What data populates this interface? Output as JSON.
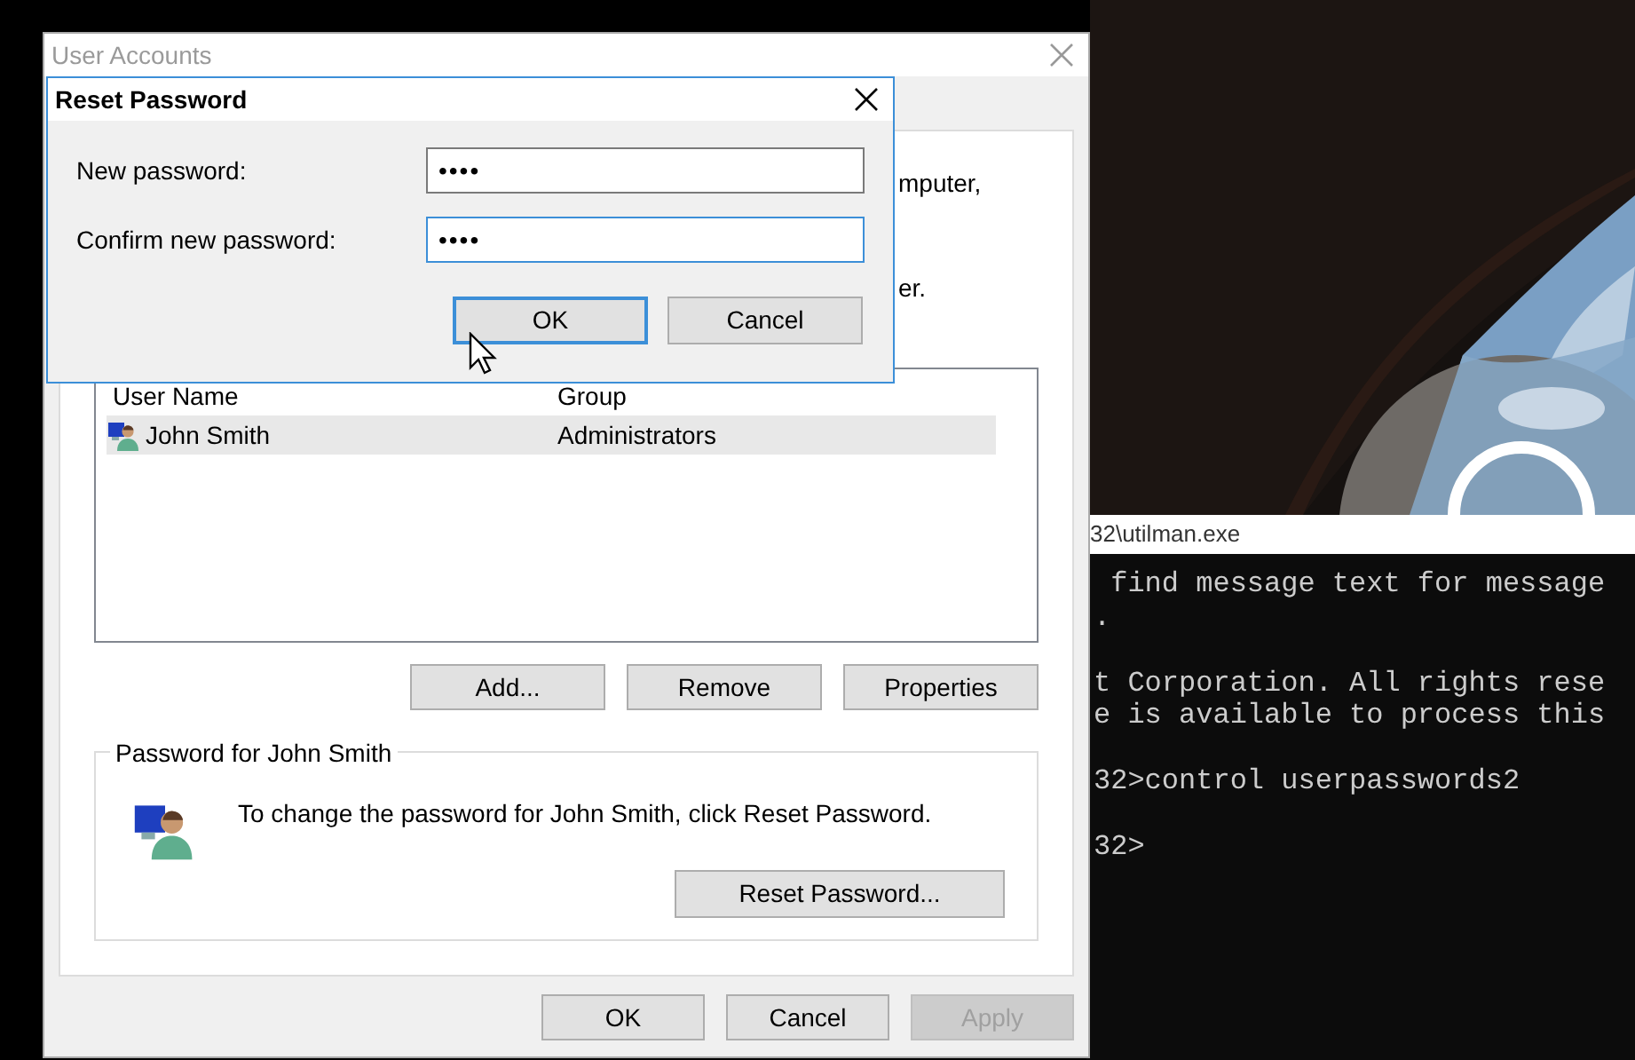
{
  "console": {
    "title": "32\\utilman.exe",
    "blocks": [
      [
        " find message text for message",
        "."
      ],
      [
        "t Corporation. All rights rese",
        "e is available to process this"
      ],
      [
        "32>control userpasswords2"
      ],
      [
        "32>"
      ]
    ]
  },
  "user_accounts": {
    "title": "User Accounts",
    "active": false,
    "partial_texts": [
      "mputer,",
      "er."
    ],
    "users_list": {
      "columns": [
        "User Name",
        "Group"
      ],
      "rows": [
        {
          "user_name": "John Smith",
          "group": "Administrators",
          "selected": true
        }
      ]
    },
    "list_buttons": [
      {
        "label": "Add..."
      },
      {
        "label": "Remove"
      },
      {
        "label": "Properties"
      }
    ],
    "password_group": {
      "title": "Password for John Smith",
      "text": "To change the password for John Smith, click Reset Password.",
      "button": "Reset Password..."
    },
    "buttons": [
      {
        "label": "OK",
        "disabled": false
      },
      {
        "label": "Cancel",
        "disabled": false
      },
      {
        "label": "Apply",
        "disabled": true
      }
    ]
  },
  "reset_dialog": {
    "title": "Reset Password",
    "fields": [
      {
        "label": "New password:",
        "value": "••••",
        "focused": false
      },
      {
        "label": "Confirm new password:",
        "value": "••••",
        "focused": true
      }
    ],
    "buttons": [
      {
        "label": "OK",
        "default": true
      },
      {
        "label": "Cancel",
        "default": false
      }
    ]
  }
}
